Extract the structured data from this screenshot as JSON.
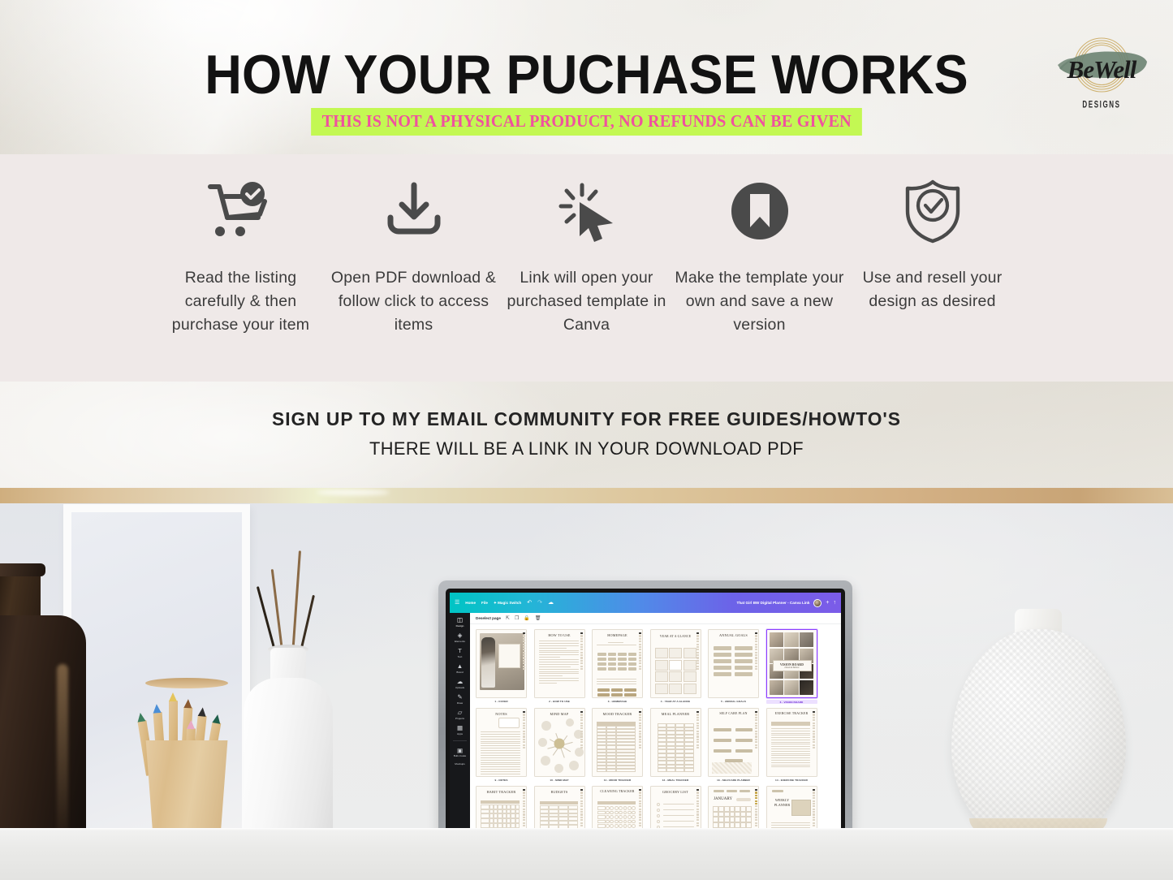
{
  "header": {
    "title": "HOW YOUR PUCHASE WORKS",
    "subtitle": "THIS IS NOT A PHYSICAL PRODUCT, NO REFUNDS CAN BE GIVEN",
    "subtitle_highlight_color": "#c3f853",
    "subtitle_text_color": "#f0519f",
    "logo": {
      "word": "BeWell",
      "sub": "DESIGNS",
      "brush_color": "#6f8574",
      "ring_color": "#c9a75a"
    }
  },
  "steps": [
    {
      "icon": "cart-check-icon",
      "caption": "Read the listing carefully & then purchase your item"
    },
    {
      "icon": "download-icon",
      "caption": "Open PDF download & follow click to access items"
    },
    {
      "icon": "cursor-click-icon",
      "caption": "Link will open your purchased template in Canva"
    },
    {
      "icon": "bookmark-circle-icon",
      "caption": "Make the template your own and save a new version"
    },
    {
      "icon": "shield-check-icon",
      "caption": "Use and resell your design as desired"
    }
  ],
  "email_band": {
    "line1": "SIGN UP TO MY EMAIL COMMUNITY FOR FREE GUIDES/HOWTO'S",
    "line2": "THERE WILL BE A LINK IN YOUR DOWNLOAD PDF"
  },
  "canva": {
    "menu": [
      "Home",
      "File",
      "Magic Switch"
    ],
    "menu_icons": [
      "hamburger-icon",
      "undo-icon",
      "redo-icon",
      "cloud-icon"
    ],
    "doc_title": "That Girl BW Digital Planner - Canva Link",
    "header_actions": [
      "avatar",
      "plus-icon",
      "share-icon"
    ],
    "rail": [
      {
        "label": "Design",
        "icon": "design-icon"
      },
      {
        "label": "Elements",
        "icon": "elements-icon"
      },
      {
        "label": "Text",
        "icon": "text-icon"
      },
      {
        "label": "Brand",
        "icon": "brand-icon"
      },
      {
        "label": "Uploads",
        "icon": "uploads-icon"
      },
      {
        "label": "Draw",
        "icon": "draw-icon"
      },
      {
        "label": "Projects",
        "icon": "projects-icon"
      },
      {
        "label": "Apps",
        "icon": "apps-icon"
      },
      {
        "label": "Bulk create",
        "icon": "bulk-create-icon"
      },
      {
        "label": "Mockups",
        "icon": "mockups-icon"
      }
    ],
    "toolbar": {
      "deselect_label": "Deselect page",
      "icons": [
        "export-icon",
        "duplicate-icon",
        "lock-icon",
        "delete-icon"
      ]
    },
    "pages": [
      {
        "label": "1 - COVER",
        "title": "",
        "selected": false
      },
      {
        "label": "2 - HOW TO USE",
        "title": "HOW TO USE",
        "selected": false
      },
      {
        "label": "3 - HOMEPAGE",
        "title": "HOMEPAGE",
        "selected": false
      },
      {
        "label": "4 - YEAR AT A GLANCE",
        "title": "YEAR AT A GLANCE",
        "selected": false
      },
      {
        "label": "5 - ANNUAL GOALS",
        "title": "ANNUAL GOALS",
        "selected": false
      },
      {
        "label": "6 - VISION BOARD",
        "title": "VISION BOARD",
        "selected": true
      },
      {
        "label": "9 - NOTES",
        "title": "NOTES",
        "selected": false
      },
      {
        "label": "10 - MIND MAP",
        "title": "MIND MAP",
        "selected": false
      },
      {
        "label": "11 - MOOD TRACKER",
        "title": "MOOD TRACKER",
        "selected": false
      },
      {
        "label": "12 - MEAL TRACKER",
        "title": "MEAL PLANNER",
        "selected": false
      },
      {
        "label": "13 - SELFCARE PLANNER",
        "title": "SELF CARE PLAN",
        "selected": false
      },
      {
        "label": "14 - EXERCISE TRACKER",
        "title": "EXERCISE TRACKER",
        "selected": false
      },
      {
        "label": "",
        "title": "HABIT TRACKER",
        "selected": false
      },
      {
        "label": "",
        "title": "BUDGETS",
        "selected": false
      },
      {
        "label": "",
        "title": "CLEANING TRACKER",
        "selected": false
      },
      {
        "label": "",
        "title": "GROCERY LIST",
        "selected": false
      },
      {
        "label": "",
        "title": "JANUARY",
        "selected": false
      },
      {
        "label": "",
        "title": "WEEKLY PLANNER",
        "selected": false
      }
    ],
    "vision_board_card": {
      "title": "VISION BOARD",
      "subtitle": "Dream & Believe"
    }
  },
  "colors": {
    "band_bg": "#efe9e8",
    "gold_divider": "#d3b084",
    "canva_accent": "#8b3dff",
    "icon_dark": "#4a4a4a"
  }
}
